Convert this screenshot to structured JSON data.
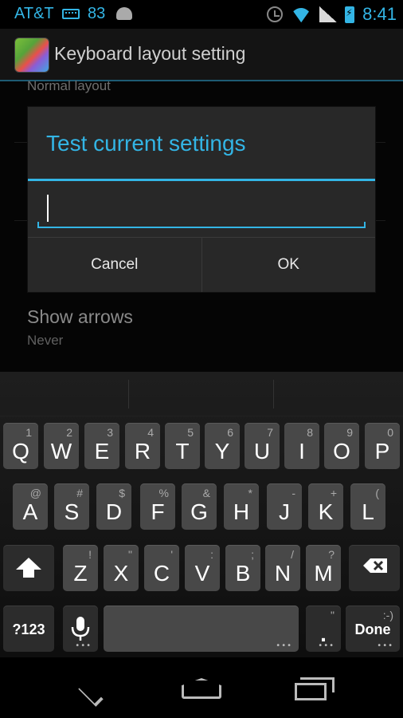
{
  "status_bar": {
    "carrier": "AT&T",
    "level": "83",
    "time": "8:41",
    "icons": [
      "keyboard-icon",
      "android-icon",
      "alarm-icon",
      "wifi-icon",
      "signal-icon",
      "battery-icon"
    ]
  },
  "action_bar": {
    "title": "Keyboard layout setting",
    "app_icon": "app-icon"
  },
  "settings": {
    "prev_item_summary": "Normal layout",
    "show_arrows_title": "Show arrows",
    "show_arrows_summary": "Never"
  },
  "dialog": {
    "title": "Test current settings",
    "input_value": "",
    "cancel_label": "Cancel",
    "ok_label": "OK"
  },
  "keyboard": {
    "row1": [
      {
        "key": "Q",
        "hint": "1"
      },
      {
        "key": "W",
        "hint": "2"
      },
      {
        "key": "E",
        "hint": "3"
      },
      {
        "key": "R",
        "hint": "4"
      },
      {
        "key": "T",
        "hint": "5"
      },
      {
        "key": "Y",
        "hint": "6"
      },
      {
        "key": "U",
        "hint": "7"
      },
      {
        "key": "I",
        "hint": "8"
      },
      {
        "key": "O",
        "hint": "9"
      },
      {
        "key": "P",
        "hint": "0"
      }
    ],
    "row2": [
      {
        "key": "A",
        "hint": "@"
      },
      {
        "key": "S",
        "hint": "#"
      },
      {
        "key": "D",
        "hint": "$"
      },
      {
        "key": "F",
        "hint": "%"
      },
      {
        "key": "G",
        "hint": "&"
      },
      {
        "key": "H",
        "hint": "*"
      },
      {
        "key": "J",
        "hint": "-"
      },
      {
        "key": "K",
        "hint": "+"
      },
      {
        "key": "L",
        "hint": "("
      }
    ],
    "row3": [
      {
        "key": "Z",
        "hint": "!"
      },
      {
        "key": "X",
        "hint": "\""
      },
      {
        "key": "C",
        "hint": "'"
      },
      {
        "key": "V",
        "hint": ":"
      },
      {
        "key": "B",
        "hint": ";"
      },
      {
        "key": "N",
        "hint": "/"
      },
      {
        "key": "M",
        "hint": "?"
      }
    ],
    "symbols_label": "?123",
    "period_label": ".",
    "period_hint": "\"",
    "done_label": "Done",
    "done_hint": ":-)"
  },
  "nav_bar": {
    "icons": [
      "back-icon",
      "home-icon",
      "recent-apps-icon"
    ]
  },
  "colors": {
    "accent": "#33b5e5",
    "key_bg": "#484848",
    "key_dark_bg": "#2c2c2c",
    "dialog_bg": "#282828"
  }
}
